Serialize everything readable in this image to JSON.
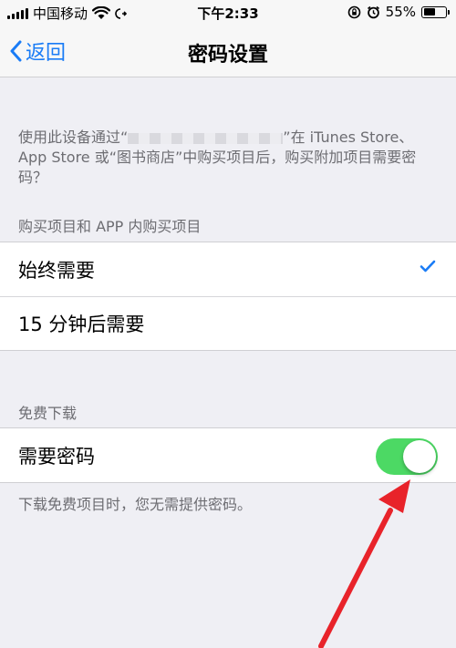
{
  "status_bar": {
    "carrier": "中国移动",
    "time": "下午2:33",
    "battery_percent": "55%",
    "battery_level": 0.55,
    "icons": [
      "signal-icon",
      "wifi-icon",
      "activity-icon",
      "rotation-lock-icon",
      "alarm-icon",
      "battery-icon"
    ]
  },
  "nav": {
    "back_label": "返回",
    "title": "密码设置"
  },
  "description": {
    "part1": "使用此设备通过“",
    "part2": "”在 iTunes Store、App Store 或“图书商店”中购买项目后，购买附加项目需要密码？"
  },
  "purchases": {
    "header": "购买项目和 APP 内购买项目",
    "options": [
      {
        "label": "始终需要",
        "selected": true
      },
      {
        "label": "15 分钟后需要",
        "selected": false
      }
    ]
  },
  "free_downloads": {
    "header": "免费下载",
    "require_password_label": "需要密码",
    "require_password_on": true,
    "note": "下载免费项目时，您无需提供密码。"
  },
  "colors": {
    "accent": "#1a7cf6",
    "toggle_on": "#4cd964",
    "annotation": "#e8232a",
    "background": "#efeff4"
  }
}
